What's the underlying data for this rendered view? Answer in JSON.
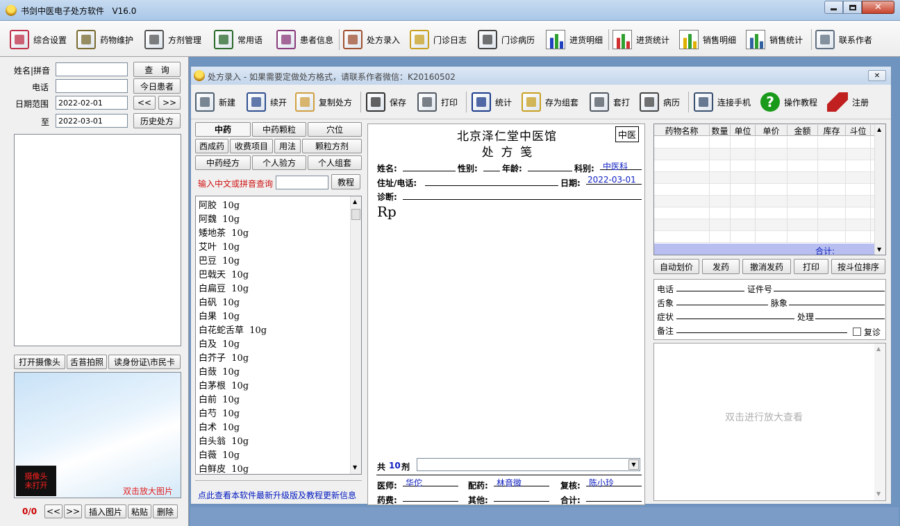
{
  "window": {
    "title": "书剑中医电子处方软件   V16.0"
  },
  "main_toolbar": [
    {
      "label": "综合设置",
      "icon": "settings-cd-icon"
    },
    {
      "label": "药物维护",
      "icon": "medicine-box-icon"
    },
    {
      "label": "方剂管理",
      "icon": "book-icon"
    },
    {
      "label": "常用语",
      "icon": "notepad-icon"
    },
    {
      "label": "患者信息",
      "icon": "patient-icon"
    },
    {
      "label": "处方录入",
      "icon": "mortar-icon"
    },
    {
      "label": "门诊日志",
      "icon": "clipboard-icon"
    },
    {
      "label": "门诊病历",
      "icon": "document-icon"
    },
    {
      "label": "进货明细",
      "icon": "bar-chart-icon"
    },
    {
      "label": "进货统计",
      "icon": "line-chart-icon"
    },
    {
      "label": "销售明细",
      "icon": "color-bars-icon"
    },
    {
      "label": "销售统计",
      "icon": "scatter-chart-icon"
    },
    {
      "label": "联系作者",
      "icon": "contact-icon"
    }
  ],
  "left": {
    "name_label": "姓名|拼音",
    "phone_label": "电话",
    "date_range_label": "日期范围",
    "to_label": "至",
    "date_from": "2022-02-01",
    "date_to": "2022-03-01",
    "query_btn": "查   询",
    "today_btn": "今日患者",
    "prev_btn": "<<",
    "next_btn": ">>",
    "history_btn": "历史处方",
    "camera_btn": "打开摄像头",
    "tongue_btn": "舌苔拍照",
    "idcard_btn": "读身份证\\市民卡",
    "camera_status": "摄像头\n未打开",
    "enlarge_hint": "双击放大图片",
    "counter": "0/0",
    "insert_btn": "插入图片",
    "paste_btn": "粘贴",
    "delete_btn": "删除"
  },
  "child": {
    "title": "处方录入 - 如果需要定做处方格式，请联系作者微信：K20160502",
    "toolbar": [
      {
        "label": "新建",
        "icon": "new-icon"
      },
      {
        "label": "续开",
        "icon": "continue-icon"
      },
      {
        "label": "复制处方",
        "icon": "folder-icon"
      },
      {
        "label": "保存",
        "icon": "save-icon"
      },
      {
        "label": "打印",
        "icon": "printer-icon"
      },
      {
        "label": "统计",
        "icon": "stats-icon"
      },
      {
        "label": "存为组套",
        "icon": "clipboard-icon"
      },
      {
        "label": "套打",
        "icon": "printer-icon"
      },
      {
        "label": "病历",
        "icon": "document-icon"
      },
      {
        "label": "连接手机",
        "icon": "computer-icon"
      },
      {
        "label": "操作教程",
        "icon": "help-icon"
      },
      {
        "label": "注册",
        "icon": "register-icon"
      }
    ],
    "tabs": [
      "中药",
      "中药颗粒",
      "穴位",
      "西成药",
      "收费项目",
      "用法",
      "颗粒方剂",
      "中药经方",
      "个人验方",
      "个人组套"
    ],
    "search_label": "输入中文或拼音查询",
    "tutorial_btn": "教程",
    "herbs": [
      "阿胶  10g",
      "阿魏  10g",
      "矮地茶  10g",
      "艾叶  10g",
      "巴豆  10g",
      "巴戟天  10g",
      "白扁豆  10g",
      "白矾  10g",
      "白果  10g",
      "白花蛇舌草  10g",
      "白及  10g",
      "白芥子  10g",
      "白蔹  10g",
      "白茅根  10g",
      "白前  10g",
      "白芍  10g",
      "白术  10g",
      "白头翁  10g",
      "白薇  10g",
      "白鲜皮  10g"
    ],
    "update_link": "点此查看本软件最新升级版及教程更新信息",
    "rx": {
      "clinic": "北京泽仁堂中医馆",
      "title": "处  方  笺",
      "badge": "中医",
      "name_label": "姓名:",
      "sex_label": "性别:",
      "age_label": "年龄:",
      "dept_label": "科别:",
      "dept_value": "中医科",
      "address_label": "住址/电话:",
      "date_label": "日期:",
      "date_value": "2022-03-01",
      "diagnosis_label": "诊断:",
      "rp": "Rp",
      "total_prefix": "共",
      "dose_count": "10",
      "dose_unit": "剂",
      "doctor_label": "医师:",
      "doctor": "华佗",
      "dispense_label": "配药:",
      "dispenser": "林音微",
      "review_label": "复核:",
      "reviewer": "陈小玲",
      "fee_label": "药费:",
      "other_label": "其他:",
      "sum_label": "合计:"
    },
    "table": {
      "columns": [
        "药物名称",
        "数量",
        "单位",
        "单价",
        "金额",
        "库存",
        "斗位"
      ],
      "total_label": "合计:"
    },
    "actions": [
      "自动划价",
      "发药",
      "撤消发药",
      "打印",
      "按斗位排序"
    ],
    "info": {
      "phone": "电话",
      "idno": "证件号",
      "tongue": "舌象",
      "pulse": "脉象",
      "symptom": "症状",
      "treat": "处理",
      "remark": "备注",
      "revisit": "复诊"
    },
    "image_hint": "双击进行放大查看"
  }
}
